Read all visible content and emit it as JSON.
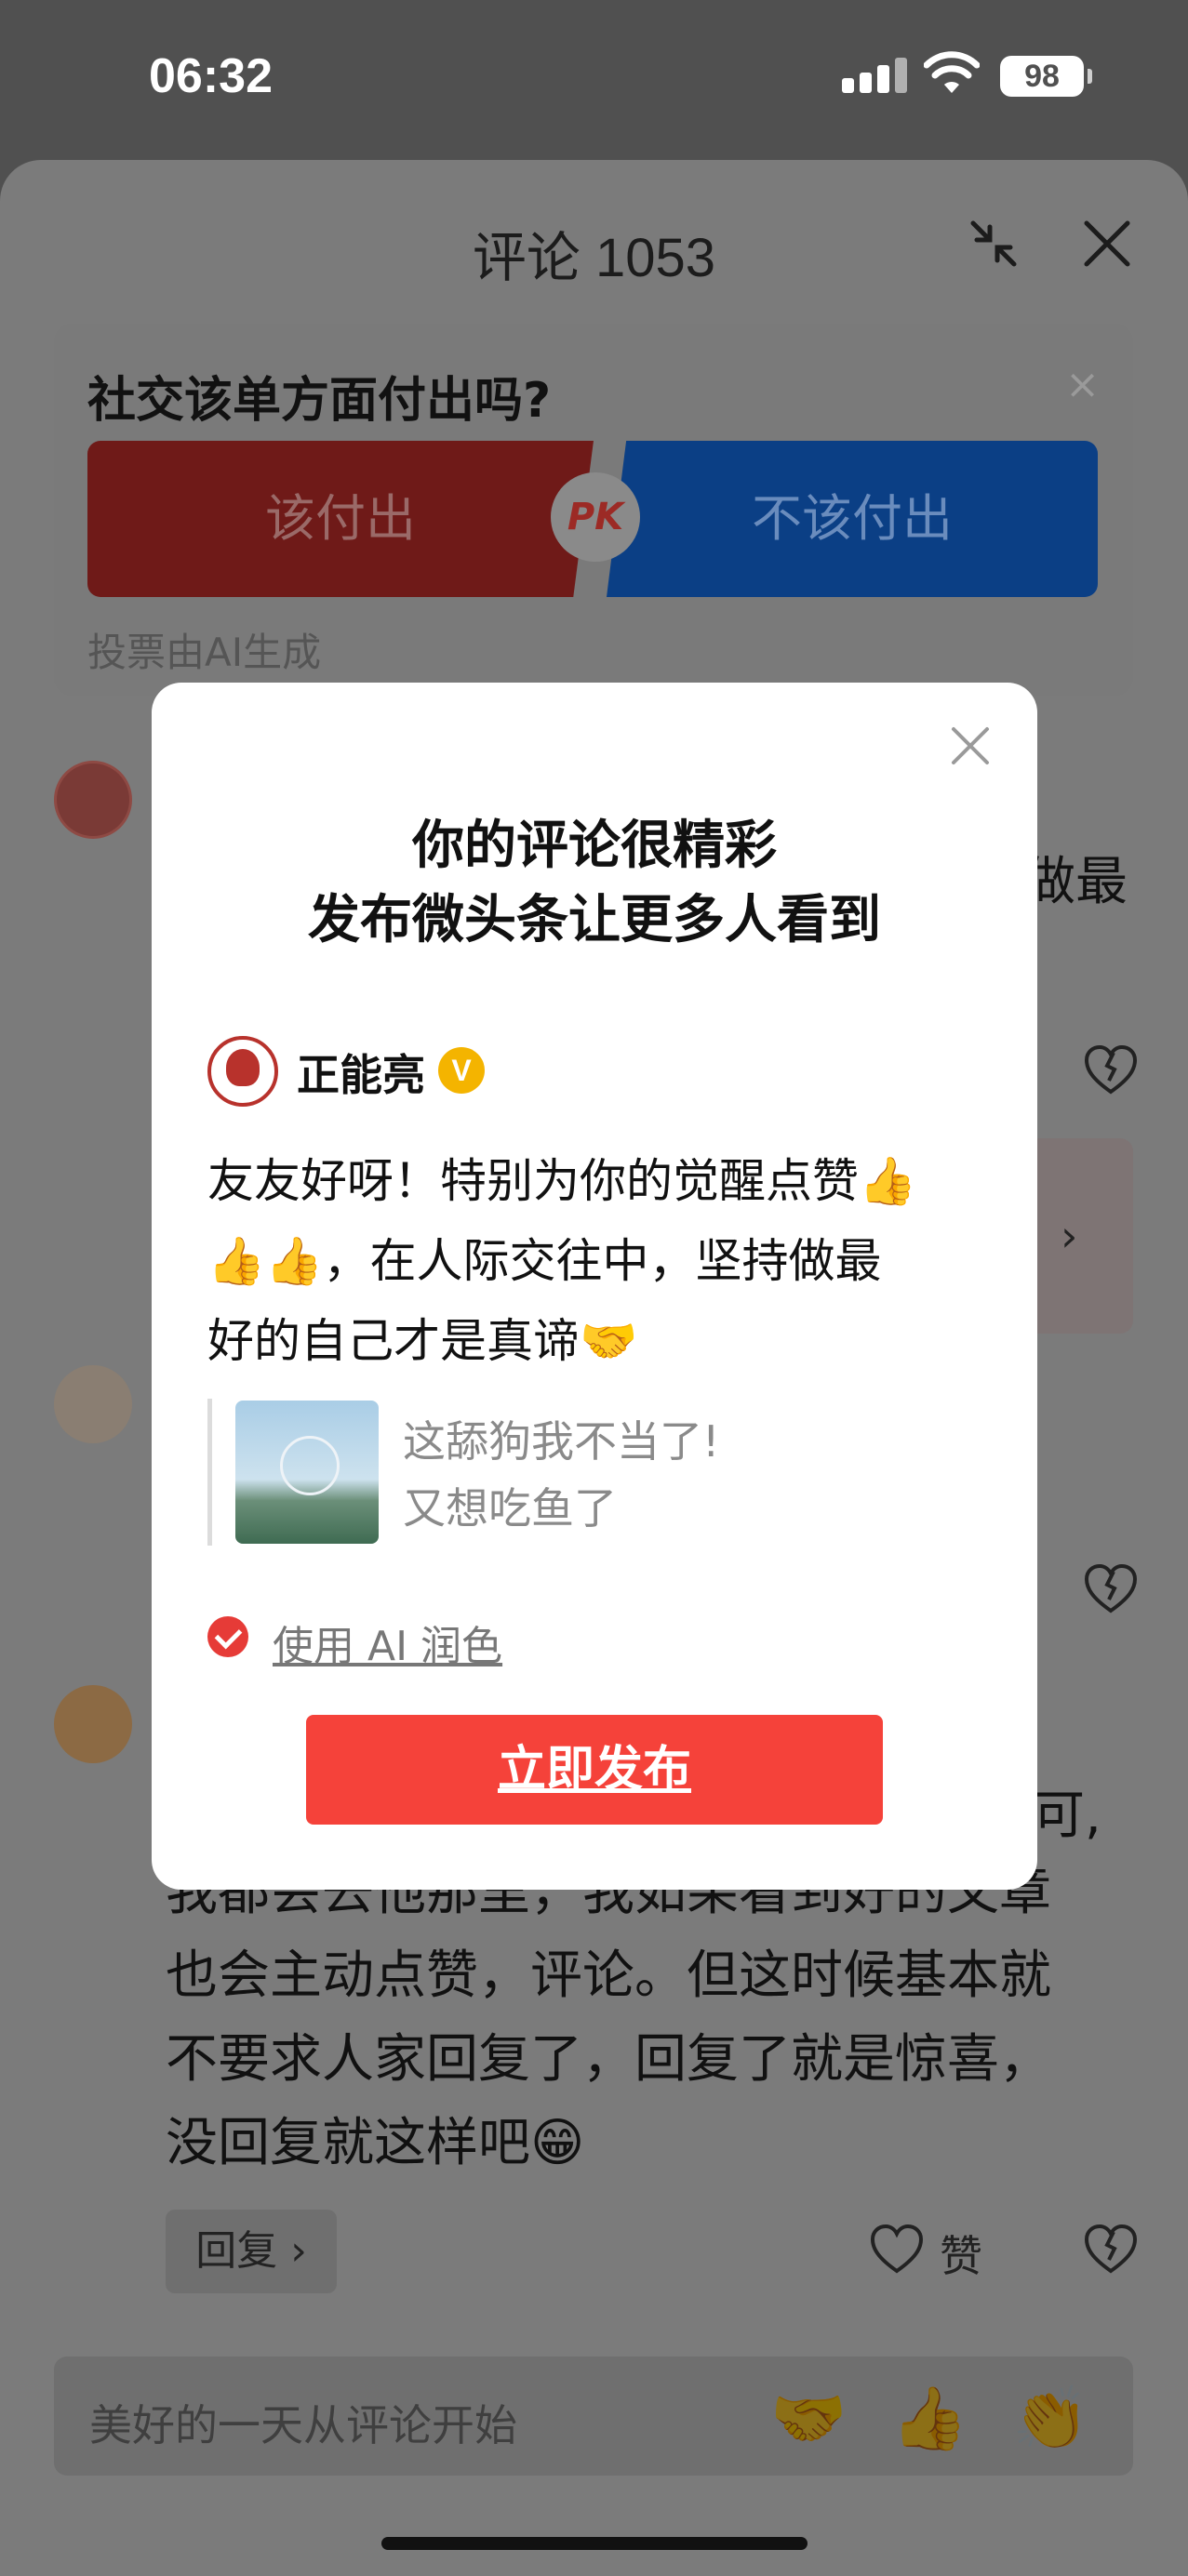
{
  "status_bar": {
    "time": "06:32",
    "battery": "98"
  },
  "sheet": {
    "title": "评论 1053"
  },
  "vote": {
    "question": "社交该单方面付出吗?",
    "close": "×",
    "option_yes": "该付出",
    "option_no": "不该付出",
    "pk": "PK",
    "footer": "投票由AI生成"
  },
  "comments": {
    "fragment_1": "做最",
    "fragment_2": "可,",
    "lines": [
      "我都会去他那里，我如果看到好的文章",
      "也会主动点赞，评论。但这时候基本就",
      "不要求人家回复了，回复了就是惊喜，",
      "没回复就这样吧😁"
    ],
    "reply_label": "回复 ›",
    "like_label": "赞"
  },
  "input": {
    "placeholder": "美好的一天从评论开始",
    "emojis": [
      "🤝",
      "👍",
      "👏"
    ]
  },
  "popup": {
    "title_line1": "你的评论很精彩",
    "title_line2": "发布微头条让更多人看到",
    "author": "正能亮",
    "verified": "V",
    "post_lines": [
      "友友好呀！特别为你的觉醒点赞👍",
      "👍👍，在人际交往中，坚持做最",
      "好的自己才是真谛🤝"
    ],
    "quote_line1": "这舔狗我不当了!",
    "quote_line2": "又想吃鱼了",
    "ai_option": "使用 AI 润色",
    "publish_button": "立即发布"
  },
  "colors": {
    "publish": "#f5423a",
    "vote_yes": "#6f1a18",
    "vote_no": "#0b3f85",
    "verified": "#f4b400"
  }
}
